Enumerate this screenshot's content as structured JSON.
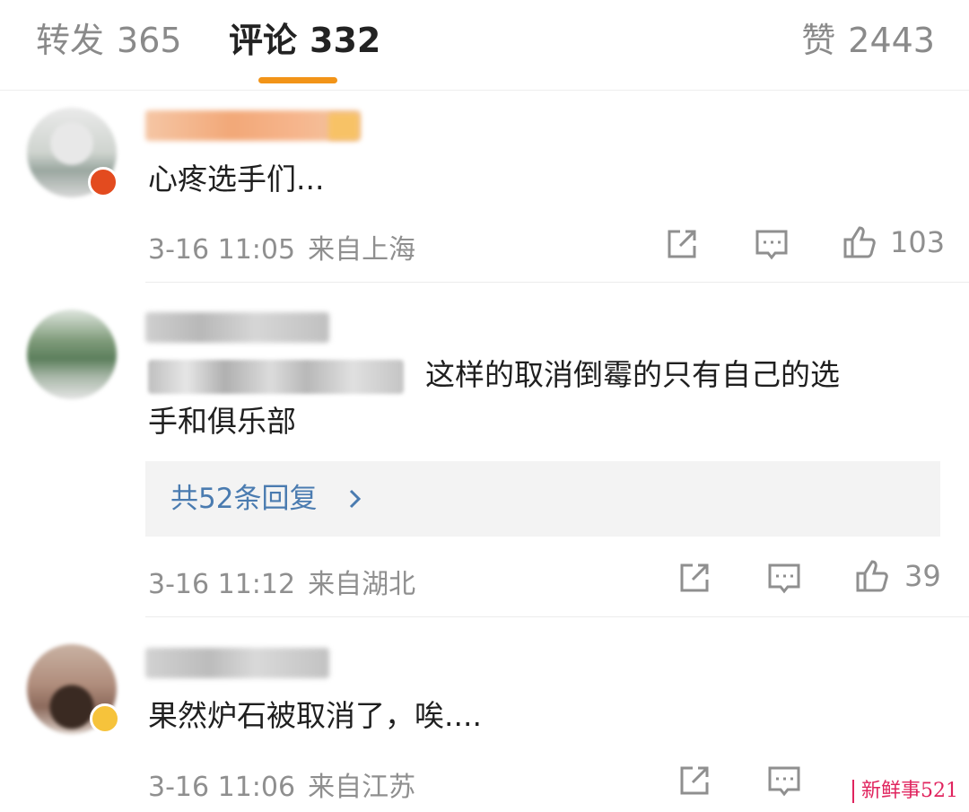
{
  "tabs": {
    "forward": {
      "label": "转发",
      "count": "365"
    },
    "comments": {
      "label": "评论",
      "count": "332"
    },
    "likes": {
      "label": "赞",
      "count": "2443"
    }
  },
  "comments": [
    {
      "text": "心疼选手们...",
      "date": "3-16 11:05",
      "location": "来自上海",
      "likes": "103"
    },
    {
      "text_line1": "这样的取消倒霉的只有自己的选",
      "text_line2": "手和俱乐部",
      "replies_label": "共52条回复",
      "date": "3-16 11:12",
      "location": "来自湖北",
      "likes": "39"
    },
    {
      "text": "果然炉石被取消了，唉....",
      "date": "3-16 11:06",
      "location": "来自江苏",
      "likes": ""
    }
  ],
  "watermark": "新鲜事521",
  "colors": {
    "accent": "#f29418",
    "link": "#4a7bb0",
    "muted": "#8f8f8f"
  },
  "icons": [
    "forward-icon",
    "comment-icon",
    "like-icon",
    "chevron-right-icon"
  ]
}
